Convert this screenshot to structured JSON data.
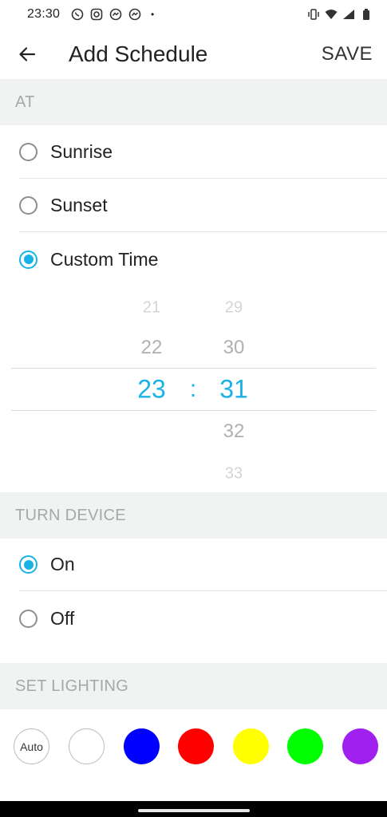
{
  "status_bar": {
    "time": "23:30",
    "notification_icons": [
      "whatsapp-icon",
      "instagram-icon",
      "messenger-icon",
      "messenger-icon"
    ],
    "dot": "•"
  },
  "app_bar": {
    "title": "Add Schedule",
    "save_label": "SAVE"
  },
  "at_section": {
    "header": "AT",
    "options": [
      {
        "label": "Sunrise",
        "checked": false
      },
      {
        "label": "Sunset",
        "checked": false
      },
      {
        "label": "Custom Time",
        "checked": true
      }
    ]
  },
  "time_picker": {
    "hours": [
      "21",
      "22",
      "23"
    ],
    "minutes": [
      "29",
      "30",
      "31",
      "32",
      "33"
    ],
    "separator": ":",
    "selected_hour": "23",
    "selected_minute": "31"
  },
  "turn_device_section": {
    "header": "TURN DEVICE",
    "options": [
      {
        "label": "On",
        "checked": true
      },
      {
        "label": "Off",
        "checked": false
      }
    ]
  },
  "lighting_section": {
    "header": "SET LIGHTING",
    "auto_label": "Auto",
    "colors": [
      "#ffffff",
      "#0000ff",
      "#ff0000",
      "#ffff00",
      "#00ff00",
      "#a020f0"
    ]
  },
  "accent_color": "#19b2e6"
}
